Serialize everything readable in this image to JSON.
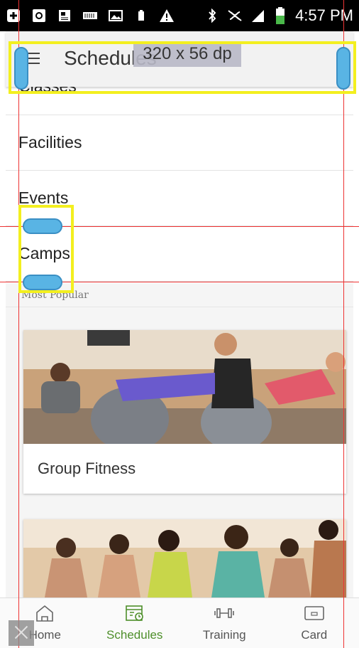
{
  "status_bar": {
    "time": "4:57 PM",
    "icons": [
      "add-box-icon",
      "chat-icon",
      "news-icon",
      "keyboard-icon",
      "image-icon",
      "battery-small-icon",
      "warning-icon",
      "bluetooth-icon",
      "no-sim-icon",
      "signal-icon",
      "battery-icon"
    ]
  },
  "app_bar": {
    "title": "Schedules",
    "dimension_label": "320 x 56 dp"
  },
  "menu": {
    "items": [
      {
        "label": "Classes"
      },
      {
        "label": "Facilities"
      },
      {
        "label": "Events"
      },
      {
        "label": "Camps"
      }
    ]
  },
  "section": {
    "header": "Most Popular"
  },
  "cards": [
    {
      "label": "Group Fitness"
    },
    {
      "label": ""
    }
  ],
  "bottom_nav": {
    "items": [
      {
        "label": "Home",
        "icon": "home-icon",
        "active": false
      },
      {
        "label": "Schedules",
        "icon": "calendar-clock-icon",
        "active": true
      },
      {
        "label": "Training",
        "icon": "dumbbell-icon",
        "active": false
      },
      {
        "label": "Card",
        "icon": "card-icon",
        "active": false
      }
    ],
    "active_color": "#4e8f2a"
  },
  "overlay": {
    "guide_color": "#e33333",
    "highlight_color": "#f3ef1f",
    "handle_color": "#59b4e4"
  }
}
